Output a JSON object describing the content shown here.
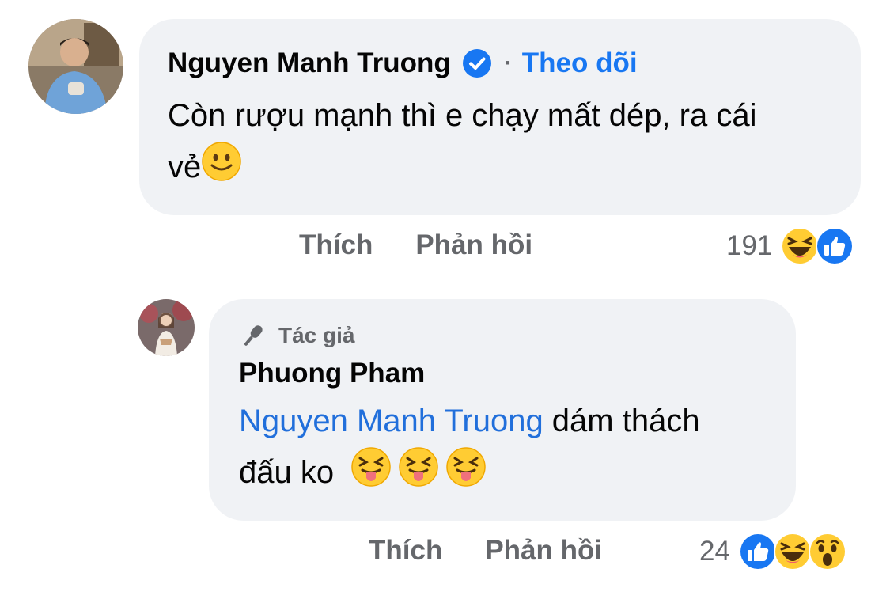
{
  "comment1": {
    "author": "Nguyen Manh Truong",
    "separator": "·",
    "follow_label": "Theo dõi",
    "text_line1": "Còn rượu mạnh thì e chạy mất dép, ra cái",
    "text_line2": "vẻ",
    "emoji_icon": "slightly-smiling-face-icon",
    "like_label": "Thích",
    "reply_label": "Phản hồi",
    "reaction_count": "191",
    "reactions": [
      "haha-icon",
      "like-icon"
    ]
  },
  "comment2": {
    "badge_label": "Tác giả",
    "badge_icon": "microphone-icon",
    "author": "Phuong Pham",
    "mention": "Nguyen Manh Truong",
    "text_after_mention": " dám thách",
    "text_line2": "đấu ko",
    "emojis": [
      "squinting-tongue-face-icon",
      "squinting-tongue-face-icon",
      "squinting-tongue-face-icon"
    ],
    "like_label": "Thích",
    "reply_label": "Phản hồi",
    "reaction_count": "24",
    "reactions": [
      "like-icon",
      "haha-icon",
      "wow-icon"
    ]
  },
  "colors": {
    "bubble": "#f0f2f5",
    "link": "#1877f2",
    "meta": "#65676b"
  }
}
